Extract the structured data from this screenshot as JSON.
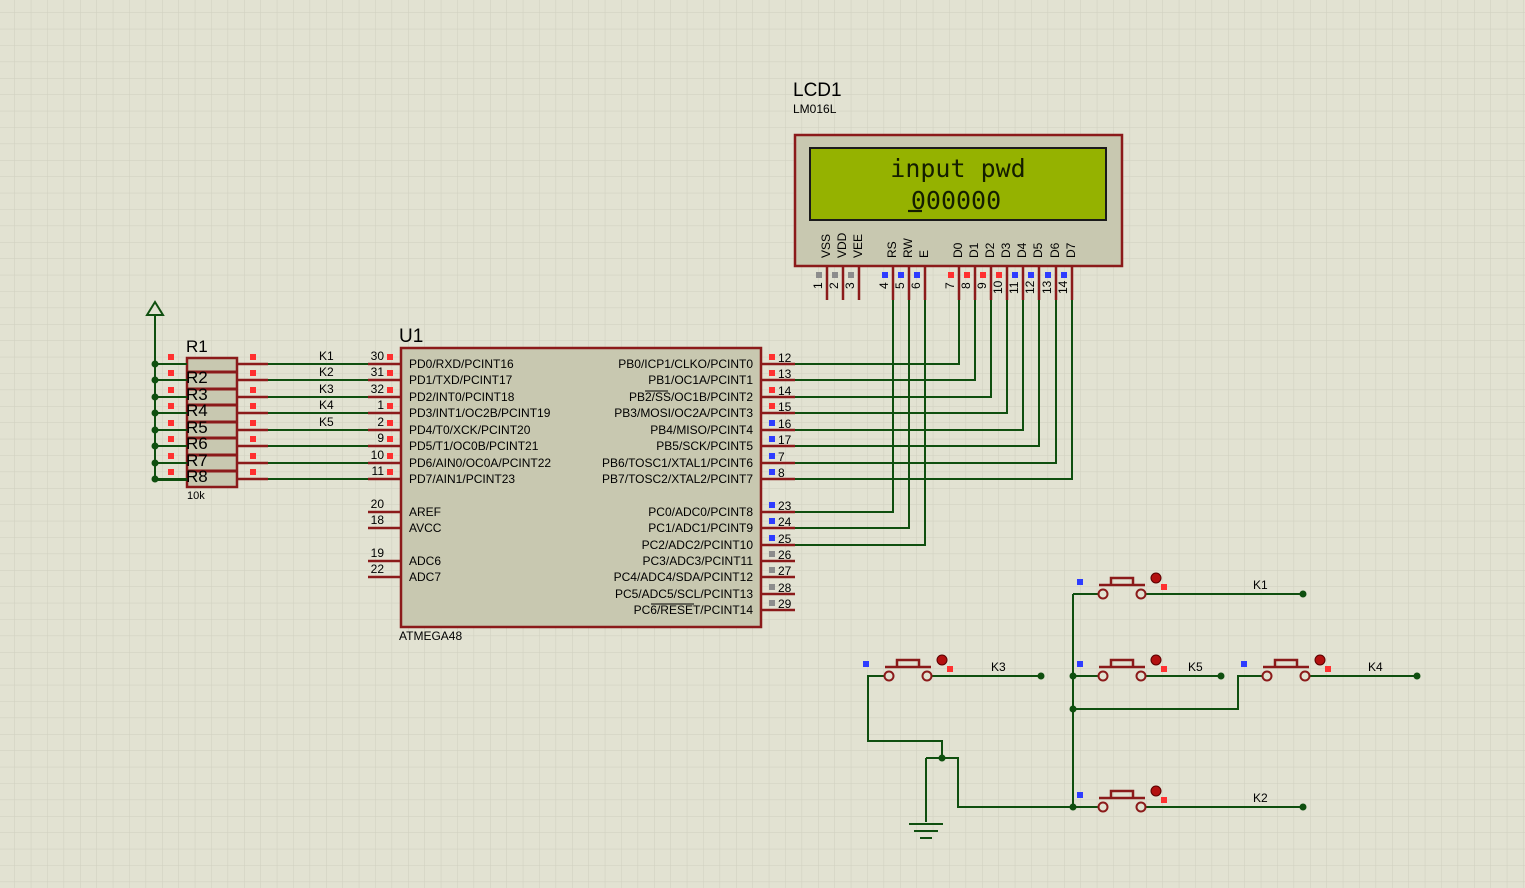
{
  "lcd": {
    "ref": "LCD1",
    "part": "LM016L",
    "line1": "input pwd",
    "line2": "000000",
    "pins": [
      {
        "name": "VSS",
        "num": "1"
      },
      {
        "name": "VDD",
        "num": "2"
      },
      {
        "name": "VEE",
        "num": "3"
      },
      {
        "name": "RS",
        "num": "4"
      },
      {
        "name": "RW",
        "num": "5"
      },
      {
        "name": "E",
        "num": "6"
      },
      {
        "name": "D0",
        "num": "7"
      },
      {
        "name": "D1",
        "num": "8"
      },
      {
        "name": "D2",
        "num": "9"
      },
      {
        "name": "D3",
        "num": "10"
      },
      {
        "name": "D4",
        "num": "11"
      },
      {
        "name": "D5",
        "num": "12"
      },
      {
        "name": "D6",
        "num": "13"
      },
      {
        "name": "D7",
        "num": "14"
      }
    ]
  },
  "mcu": {
    "ref": "U1",
    "part": "ATMEGA48",
    "left_pins": [
      {
        "num": "30",
        "name": "PD0/RXD/PCINT16"
      },
      {
        "num": "31",
        "name": "PD1/TXD/PCINT17"
      },
      {
        "num": "32",
        "name": "PD2/INT0/PCINT18"
      },
      {
        "num": "1",
        "name": "PD3/INT1/OC2B/PCINT19"
      },
      {
        "num": "2",
        "name": "PD4/T0/XCK/PCINT20"
      },
      {
        "num": "9",
        "name": "PD5/T1/OC0B/PCINT21"
      },
      {
        "num": "10",
        "name": "PD6/AIN0/OC0A/PCINT22"
      },
      {
        "num": "11",
        "name": "PD7/AIN1/PCINT23"
      },
      {
        "num": "20",
        "name": "AREF"
      },
      {
        "num": "18",
        "name": "AVCC"
      },
      {
        "num": "19",
        "name": "ADC6"
      },
      {
        "num": "22",
        "name": "ADC7"
      }
    ],
    "right_pins": [
      {
        "num": "12",
        "name": "PB0/ICP1/CLKO/PCINT0"
      },
      {
        "num": "13",
        "name": "PB1/OC1A/PCINT1"
      },
      {
        "num": "14",
        "name": "PB2/SS/OC1B/PCINT2"
      },
      {
        "num": "15",
        "name": "PB3/MOSI/OC2A/PCINT3"
      },
      {
        "num": "16",
        "name": "PB4/MISO/PCINT4"
      },
      {
        "num": "17",
        "name": "PB5/SCK/PCINT5"
      },
      {
        "num": "7",
        "name": "PB6/TOSC1/XTAL1/PCINT6"
      },
      {
        "num": "8",
        "name": "PB7/TOSC2/XTAL2/PCINT7"
      },
      {
        "num": "23",
        "name": "PC0/ADC0/PCINT8"
      },
      {
        "num": "24",
        "name": "PC1/ADC1/PCINT9"
      },
      {
        "num": "25",
        "name": "PC2/ADC2/PCINT10"
      },
      {
        "num": "26",
        "name": "PC3/ADC3/PCINT11"
      },
      {
        "num": "27",
        "name": "PC4/ADC4/SDA/PCINT12"
      },
      {
        "num": "28",
        "name": "PC5/ADC5/SCL/PCINT13"
      },
      {
        "num": "29",
        "name": "PC6/RESET/PCINT14"
      }
    ]
  },
  "resistor_pack": {
    "refs": [
      "R1",
      "R2",
      "R3",
      "R4",
      "R5",
      "R6",
      "R7",
      "R8"
    ],
    "value": "10k"
  },
  "net_labels_left": [
    "K1",
    "K2",
    "K3",
    "K4",
    "K5"
  ],
  "buttons": [
    {
      "net": "K1"
    },
    {
      "net": "K3"
    },
    {
      "net": "K5"
    },
    {
      "net": "K4"
    },
    {
      "net": "K2"
    }
  ],
  "colors": {
    "background": "#e2e2d2",
    "grid": "#cfcfbf",
    "component_outline": "#8b1a1a",
    "component_fill": "#c8c8b0",
    "wire": "#0f4f0f",
    "lcd_screen": "#95b200",
    "pin_marker_red": "#ff3030",
    "pin_marker_blue": "#2e3cff",
    "pin_marker_gray": "#8c8c8c"
  }
}
